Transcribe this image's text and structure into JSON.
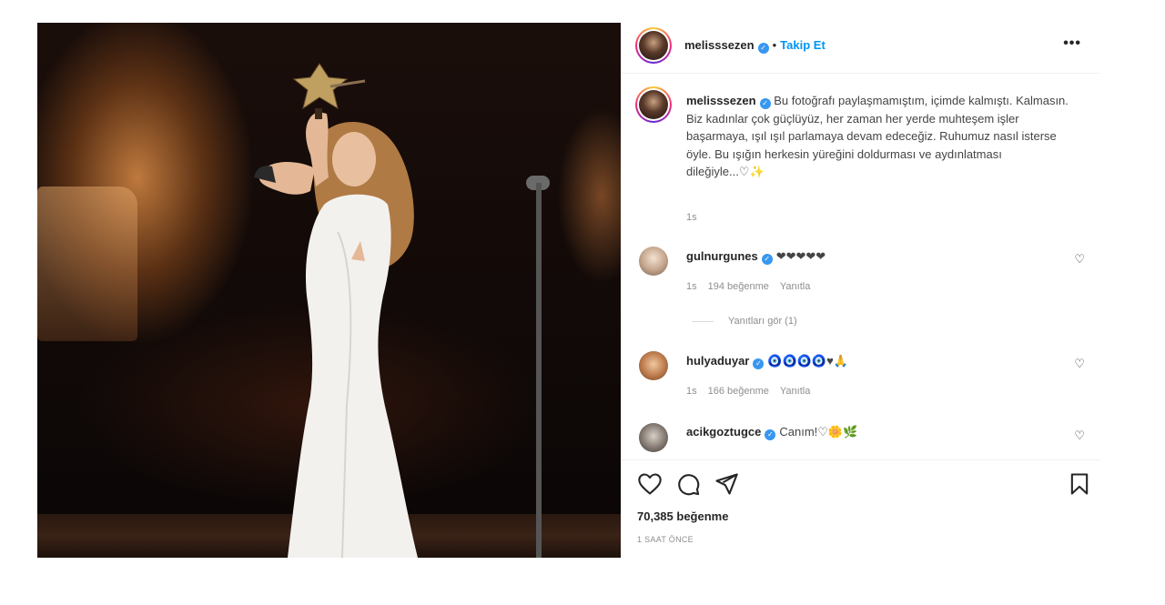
{
  "post": {
    "author": "melisssezen",
    "follow_label": "Takip Et",
    "more_label": "•••",
    "separator": "•",
    "verified_mark": "✓"
  },
  "caption": {
    "username": "melisssezen",
    "text": "Bu fotoğrafı paylaşmamıştım, içimde kalmıştı. Kalmasın.\nBiz kadınlar çok güçlüyüz, her zaman her yerde muhteşem işler başarmaya, ışıl ışıl parlamaya devam edeceğiz. Ruhumuz nasıl isterse öyle. Bu ışığın herkesin yüreğini doldurması ve aydınlatması dileğiyle...♡✨",
    "time": "1s"
  },
  "comments": [
    {
      "username": "gulnurgunes",
      "text": "❤❤❤❤❤",
      "time": "1s",
      "likes": "194 beğenme",
      "reply_label": "Yanıtla",
      "view_replies": "Yanıtları gör (1)"
    },
    {
      "username": "hulyaduyar",
      "text": "🧿🧿🧿🧿♥🙏",
      "time": "1s",
      "likes": "166 beğenme",
      "reply_label": "Yanıtla"
    },
    {
      "username": "acikgoztugce",
      "text": "Canım!♡🌼🌿"
    }
  ],
  "actions": {
    "like_count": "70,385 beğenme",
    "timestamp": "1 SAAT ÖNCE"
  },
  "icons": [
    "heart-icon",
    "comment-icon",
    "share-icon",
    "bookmark-icon",
    "more-icon",
    "verified-icon"
  ],
  "colors": {
    "accent": "#0095f6",
    "verified": "#3897f0",
    "heart": "#ed4956"
  }
}
